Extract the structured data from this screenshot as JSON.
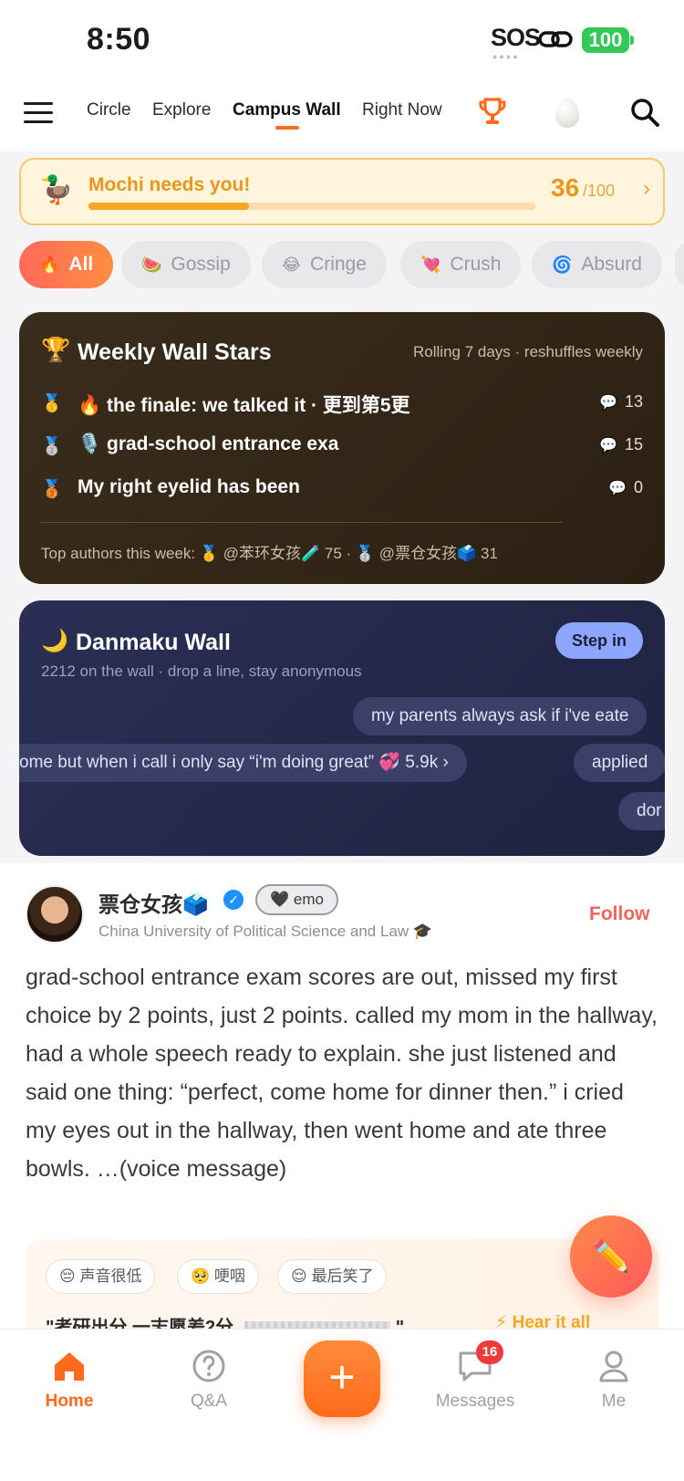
{
  "status_bar": {
    "time": "8:50",
    "sos": "SOS",
    "battery": "100"
  },
  "top_nav": {
    "tabs": [
      "Circle",
      "Explore",
      "Campus Wall",
      "Right Now"
    ],
    "active_tab": "Campus Wall"
  },
  "mochi": {
    "text": "Mochi needs you!",
    "count": "36",
    "total": "/100",
    "progress": 0.36,
    "chevron": "›"
  },
  "categories": [
    {
      "emoji": "🔥",
      "label": "All"
    },
    {
      "emoji": "🍉",
      "label": "Gossip"
    },
    {
      "emoji": "😂",
      "label": "Cringe"
    },
    {
      "emoji": "💘",
      "label": "Crush"
    },
    {
      "emoji": "🌀",
      "label": "Absurd"
    }
  ],
  "weekly_stars": {
    "icon": "🏆",
    "title": "Weekly Wall Stars",
    "subtitle": "Rolling 7 days · reshuffles weekly",
    "rows": [
      {
        "medal": "🥇",
        "emoji": "🔥",
        "text": "the finale: we talked it · 更到第5更",
        "comments": "13"
      },
      {
        "medal": "🥈",
        "emoji": "🎙️",
        "text": "grad-school entrance exa",
        "comments": "15"
      },
      {
        "medal": "🥉",
        "emoji": "",
        "text": "My right eyelid has been",
        "comments": "0"
      }
    ],
    "top_authors": "Top authors this week: 🥇 @苯环女孩🧪 75 · 🥈 @票仓女孩🗳️ 31"
  },
  "danmaku": {
    "icon": "🌙",
    "title": "Danmaku Wall",
    "subtitle": "2212 on the wall · drop a line, stay anonymous",
    "button": "Step in",
    "messages": [
      "my parents always ask if i've eate",
      "ome but when i call i only say “i'm doing great”  💞 5.9k  ›",
      "applied",
      "dor"
    ]
  },
  "post": {
    "author": "票仓女孩🗳️",
    "tag": "🖤 emo",
    "school": "China University of Political Science and Law  🎓",
    "follow": "Follow",
    "body": "grad-school entrance exam scores are out, missed my first choice by 2 points, just 2 points. called my mom in the hallway, had a whole speech ready to explain. she just listened and said one thing: “perfect, come home for dinner then.” i cried my eyes out in the hallway, then went home and ate three bowls. …(voice message)",
    "voice_chips": [
      "😔 声音很低",
      "🥺 哽咽",
      "😌 最后笑了"
    ],
    "voice_quote_start": "\"考研出分,一志愿差2分,",
    "voice_quote_end": "\"",
    "hear_link": "⚡ Hear it all"
  },
  "bottom_nav": {
    "items": [
      "Home",
      "Q&A",
      "Messages",
      "Me"
    ],
    "add": "+",
    "messages_badge": "16"
  },
  "colors": {
    "accent": "#ff6b1a",
    "follow": "#f0655a",
    "mochi": "#e8971c"
  }
}
